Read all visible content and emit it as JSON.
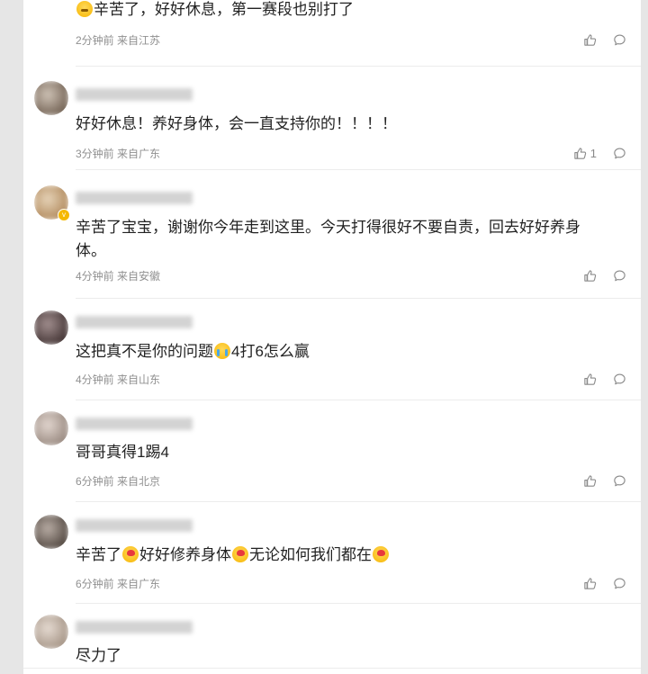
{
  "comments": [
    {
      "text_parts": [
        {
          "emoji": "sweat"
        },
        {
          "text": "辛苦了，好好休息，第一赛段也别打了"
        }
      ],
      "time": "2分钟前",
      "location": "来自江苏",
      "likes": "",
      "avatar_colors": [
        "#c9c9c9",
        "#ddd"
      ]
    },
    {
      "text_parts": [
        {
          "text": "好好休息！养好身体，会一直支持你的！！！！"
        }
      ],
      "time": "3分钟前",
      "location": "来自广东",
      "likes": "1",
      "avatar_colors": [
        "#7a6a5c",
        "#cfc3b6"
      ]
    },
    {
      "text_parts": [
        {
          "text": "辛苦了宝宝，谢谢你今年走到这里。今天打得很好不要自责，回去好好养身体。"
        }
      ],
      "time": "4分钟前",
      "location": "来自安徽",
      "likes": "",
      "avatar_colors": [
        "#b58f63",
        "#e6d3b8"
      ],
      "verified": true
    },
    {
      "text_parts": [
        {
          "text": "这把真不是你的问题"
        },
        {
          "emoji": "cry"
        },
        {
          "text": "4打6怎么赢"
        }
      ],
      "time": "4分钟前",
      "location": "来自山东",
      "likes": "",
      "avatar_colors": [
        "#4a3b3b",
        "#a28f8f"
      ]
    },
    {
      "text_parts": [
        {
          "text": "哥哥真得1踢4"
        }
      ],
      "time": "6分钟前",
      "location": "来自北京",
      "likes": "",
      "avatar_colors": [
        "#9e8f86",
        "#e2d6cf"
      ]
    },
    {
      "text_parts": [
        {
          "text": "辛苦了"
        },
        {
          "emoji": "kiss"
        },
        {
          "text": "好好修养身体"
        },
        {
          "emoji": "kiss"
        },
        {
          "text": "无论如何我们都在"
        },
        {
          "emoji": "kiss"
        }
      ],
      "time": "6分钟前",
      "location": "来自广东",
      "likes": "",
      "avatar_colors": [
        "#5a5049",
        "#b9ada5"
      ]
    },
    {
      "text_parts": [
        {
          "text": "尽力了"
        }
      ],
      "time": "",
      "location": "",
      "likes": "",
      "avatar_colors": [
        "#aa9a8c",
        "#e6dbd2"
      ]
    }
  ]
}
